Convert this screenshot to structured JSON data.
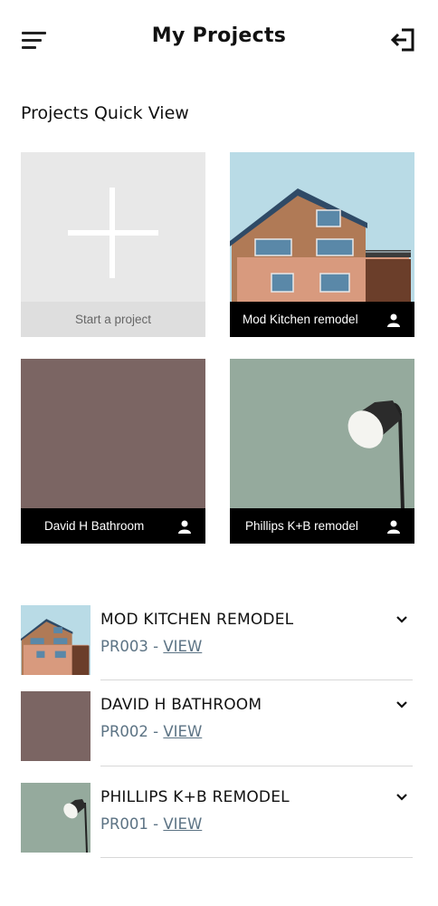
{
  "header": {
    "title": "My Projects",
    "menu_icon": "hamburger-menu-icon",
    "logout_icon": "logout-icon"
  },
  "quick_view": {
    "title": "Projects Quick View",
    "new_tile": {
      "label": "Start a project",
      "icon": "plus-icon"
    },
    "tiles": [
      {
        "label": "Mod Kitchen remodel",
        "image": "house-photo",
        "icon": "person-icon"
      },
      {
        "label": "David H Bathroom",
        "image": "brown-placeholder",
        "color": "#7b6563",
        "icon": "person-icon"
      },
      {
        "label": "Phillips K+B remodel",
        "image": "lamp-photo",
        "color": "#95aa9d",
        "icon": "person-icon"
      }
    ]
  },
  "projects": [
    {
      "title": "MOD KITCHEN REMODEL",
      "code": "PR003",
      "separator": " - ",
      "link": "VIEW"
    },
    {
      "title": "DAVID H BATHROOM",
      "code": "PR002",
      "separator": " - ",
      "link": "VIEW"
    },
    {
      "title": "PHILLIPS K+B REMODEL",
      "code": "PR001",
      "separator": " - ",
      "link": "VIEW"
    }
  ],
  "colors": {
    "accent_link": "#5c7384",
    "caption_bg": "#000000",
    "new_tile_bg": "#e8e8e8"
  }
}
